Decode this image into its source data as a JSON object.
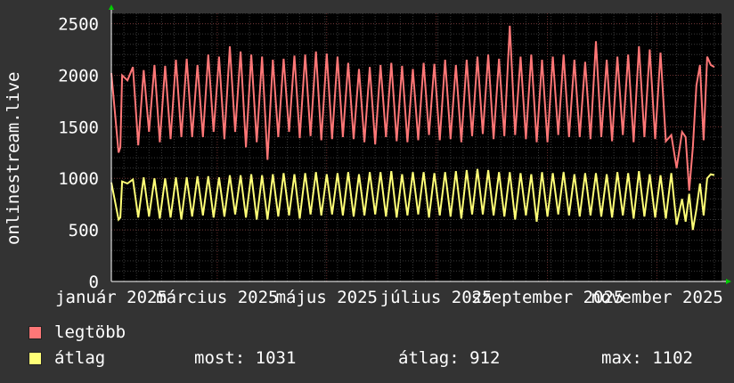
{
  "chart_data": {
    "type": "line",
    "ylabel": "onlinestream.live",
    "ylim": [
      0,
      2600
    ],
    "yticks": [
      0,
      500,
      1000,
      1500,
      2000,
      2500
    ],
    "xlim": [
      0,
      340
    ],
    "xticks": [
      {
        "day": 0,
        "label": "január 2025"
      },
      {
        "day": 59,
        "label": "március 2025"
      },
      {
        "day": 120,
        "label": "május 2025"
      },
      {
        "day": 181,
        "label": "július 2025"
      },
      {
        "day": 243,
        "label": "szeptember 2025"
      },
      {
        "day": 304,
        "label": "november 2025"
      }
    ],
    "grid": true,
    "series": [
      {
        "name": "legtöbb",
        "color": "#ff7777",
        "key": "max"
      },
      {
        "name": "átlag",
        "color": "#ffff77",
        "key": "avg"
      }
    ],
    "x": [
      0,
      4,
      5,
      6,
      9,
      12,
      15,
      18,
      21,
      24,
      27,
      30,
      33,
      36,
      39,
      42,
      45,
      48,
      51,
      54,
      57,
      60,
      63,
      66,
      69,
      72,
      75,
      78,
      81,
      84,
      87,
      90,
      93,
      96,
      99,
      102,
      105,
      108,
      111,
      114,
      117,
      120,
      123,
      126,
      129,
      132,
      135,
      138,
      141,
      144,
      147,
      150,
      153,
      156,
      159,
      162,
      165,
      168,
      171,
      174,
      177,
      180,
      183,
      186,
      189,
      192,
      195,
      198,
      201,
      204,
      207,
      210,
      213,
      216,
      219,
      222,
      225,
      228,
      231,
      234,
      237,
      240,
      243,
      246,
      249,
      252,
      255,
      258,
      261,
      264,
      267,
      270,
      273,
      276,
      279,
      282,
      285,
      288,
      291,
      294,
      297,
      300,
      303,
      306,
      309,
      312,
      315,
      318,
      320,
      322,
      324,
      326,
      328,
      330,
      332,
      334,
      336,
      338,
      340
    ],
    "max": [
      2020,
      1250,
      1300,
      2000,
      1950,
      2080,
      1320,
      2050,
      1450,
      2100,
      1350,
      2090,
      1380,
      2150,
      1400,
      2160,
      1400,
      2100,
      1400,
      2200,
      1450,
      2180,
      1380,
      2280,
      1450,
      2230,
      1300,
      2200,
      1350,
      2180,
      1180,
      2150,
      1400,
      2160,
      1450,
      2190,
      1390,
      2200,
      1410,
      2230,
      1370,
      2210,
      1380,
      2180,
      1400,
      2120,
      1380,
      2060,
      1350,
      2080,
      1330,
      2100,
      1400,
      2120,
      1360,
      2090,
      1350,
      2060,
      1370,
      2120,
      1420,
      2110,
      1370,
      2150,
      1380,
      2100,
      1350,
      2150,
      1410,
      2180,
      1430,
      2200,
      1380,
      2160,
      1410,
      2480,
      1420,
      2180,
      1380,
      2200,
      1350,
      2150,
      1350,
      2180,
      1420,
      2200,
      1400,
      2150,
      1400,
      2130,
      1380,
      2330,
      1400,
      2150,
      1360,
      2180,
      1420,
      2200,
      1350,
      2280,
      1400,
      2250,
      1380,
      2220,
      1360,
      1420,
      1100,
      1450,
      1400,
      880,
      1300,
      1900,
      2100,
      1370,
      2180,
      2100,
      2080
    ],
    "avg": [
      960,
      600,
      620,
      970,
      950,
      990,
      620,
      1010,
      630,
      1000,
      610,
      1000,
      620,
      1010,
      600,
      1010,
      630,
      1020,
      640,
      1020,
      620,
      1010,
      630,
      1030,
      650,
      1030,
      620,
      1040,
      600,
      1030,
      600,
      1040,
      630,
      1050,
      640,
      1040,
      610,
      1050,
      650,
      1060,
      640,
      1040,
      650,
      1050,
      640,
      1060,
      630,
      1040,
      640,
      1060,
      650,
      1060,
      630,
      1070,
      620,
      1040,
      640,
      1060,
      650,
      1060,
      620,
      1050,
      640,
      1060,
      630,
      1070,
      610,
      1080,
      650,
      1090,
      650,
      1080,
      640,
      1060,
      630,
      1060,
      600,
      1050,
      640,
      1040,
      580,
      1060,
      630,
      1050,
      650,
      1060,
      640,
      1040,
      630,
      1050,
      640,
      1050,
      630,
      1040,
      620,
      1060,
      640,
      1050,
      610,
      1070,
      630,
      1040,
      620,
      1030,
      610,
      1050,
      550,
      800,
      580,
      850,
      500,
      700,
      950,
      640,
      1000,
      1040,
      1031
    ]
  },
  "legend": {
    "max_label": "legtöbb",
    "avg_label": "átlag",
    "now": "most: 1031",
    "average": "átlag: 912",
    "maximum": "max: 1102"
  }
}
